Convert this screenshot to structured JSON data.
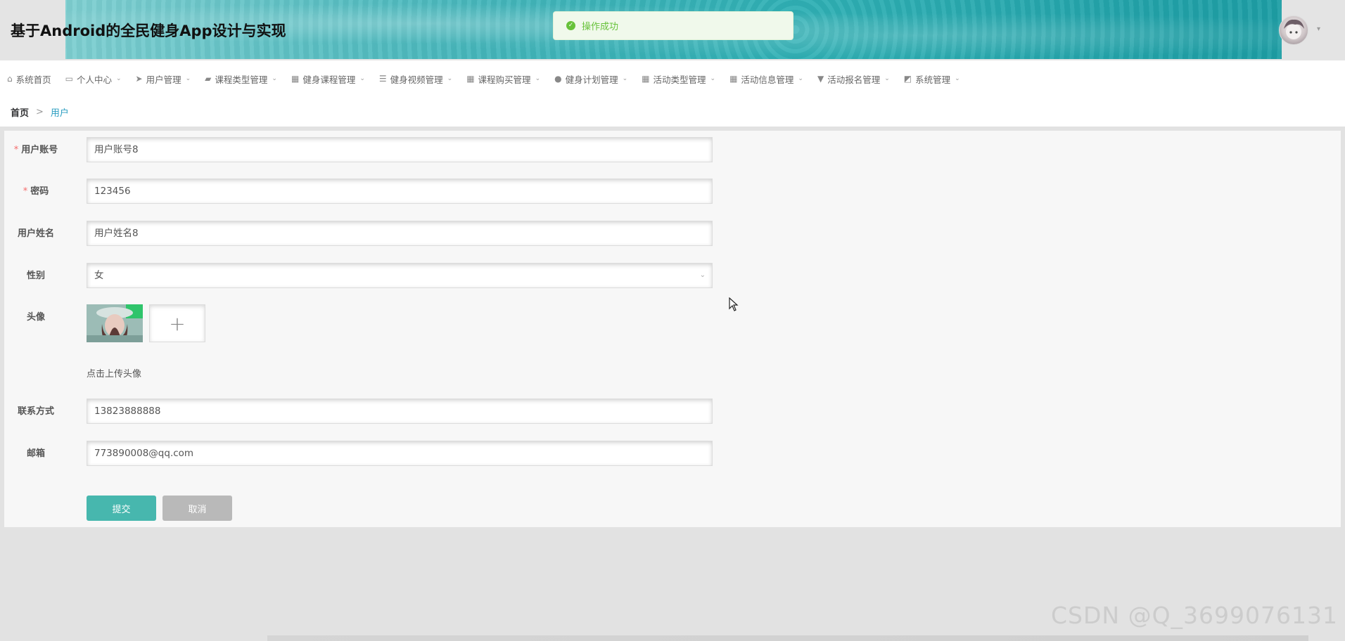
{
  "header": {
    "title": "基于Android的全民健身App设计与实现",
    "toast": "操作成功"
  },
  "nav": {
    "items": [
      {
        "label": "系统首页",
        "icon": "home-icon",
        "dropdown": false
      },
      {
        "label": "个人中心",
        "icon": "card-icon",
        "dropdown": true
      },
      {
        "label": "用户管理",
        "icon": "send-icon",
        "dropdown": true
      },
      {
        "label": "课程类型管理",
        "icon": "thumb-up-icon",
        "dropdown": true
      },
      {
        "label": "健身课程管理",
        "icon": "grid-icon",
        "dropdown": true
      },
      {
        "label": "健身视频管理",
        "icon": "list-icon",
        "dropdown": true
      },
      {
        "label": "课程购买管理",
        "icon": "grid-icon",
        "dropdown": true
      },
      {
        "label": "健身计划管理",
        "icon": "user-icon",
        "dropdown": true
      },
      {
        "label": "活动类型管理",
        "icon": "grid-icon",
        "dropdown": true
      },
      {
        "label": "活动信息管理",
        "icon": "grid-icon",
        "dropdown": true
      },
      {
        "label": "活动报名管理",
        "icon": "pin-icon",
        "dropdown": true
      },
      {
        "label": "系统管理",
        "icon": "chart-icon",
        "dropdown": true
      }
    ]
  },
  "breadcrumb": {
    "home": "首页",
    "separator": ">",
    "current": "用户"
  },
  "form": {
    "account": {
      "label": "用户账号",
      "value": "用户账号8",
      "required": true
    },
    "password": {
      "label": "密码",
      "value": "123456",
      "required": true
    },
    "name": {
      "label": "用户姓名",
      "value": "用户姓名8"
    },
    "gender": {
      "label": "性别",
      "value": "女"
    },
    "avatar": {
      "label": "头像",
      "hint": "点击上传头像",
      "add": "+"
    },
    "phone": {
      "label": "联系方式",
      "value": "13823888888"
    },
    "email": {
      "label": "邮箱",
      "value": "773890008@qq.com"
    },
    "submit": "提交",
    "cancel": "取消"
  },
  "watermark": "CSDN @Q_3699076131",
  "colors": {
    "primary": "#47b7ae",
    "cancel": "#b9b9b9",
    "toast_text": "#67c23a",
    "required": "#f56c6c",
    "link": "#2a9dc0"
  }
}
